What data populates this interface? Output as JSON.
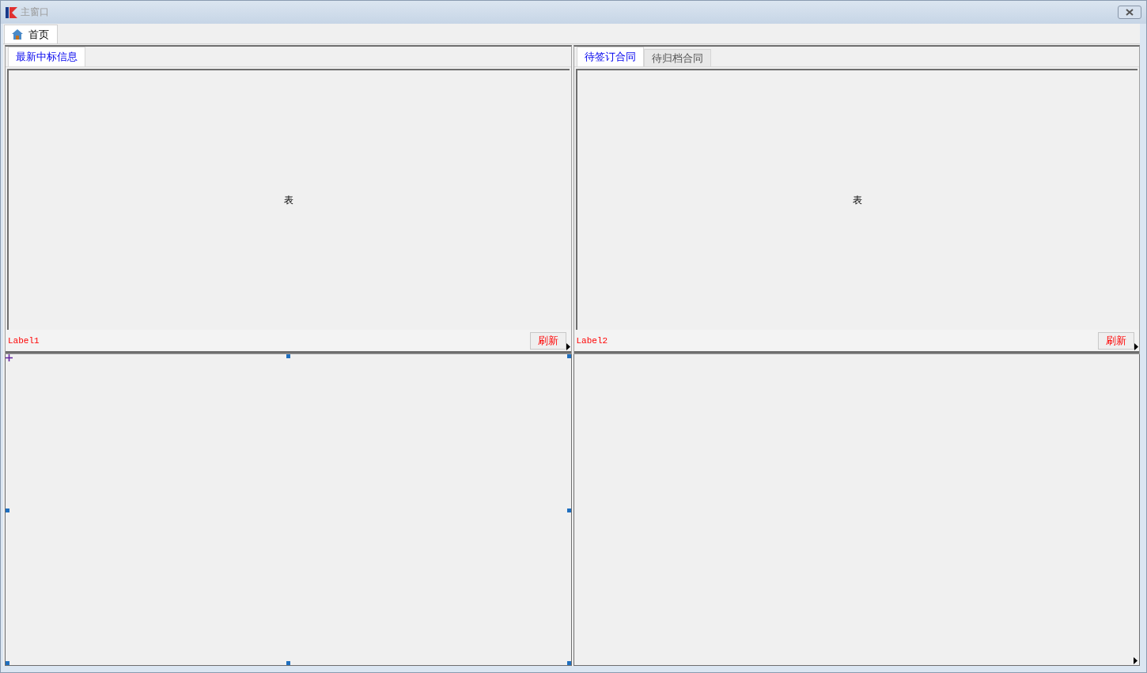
{
  "window": {
    "title": "主窗口"
  },
  "main_tabs": [
    {
      "label": "首页",
      "selected": true
    }
  ],
  "top_panels": [
    {
      "tabs": [
        {
          "label": "最新中标信息",
          "selected": true
        }
      ],
      "table_label": "表",
      "footer_label": "Label1",
      "refresh_button": "刷新"
    },
    {
      "tabs": [
        {
          "label": "待签订合同",
          "selected": true
        },
        {
          "label": "待归档合同",
          "selected": false
        }
      ],
      "table_label": "表",
      "footer_label": "Label2",
      "refresh_button": "刷新"
    }
  ],
  "bottom_panels": [
    {
      "selected": true
    },
    {
      "selected": false
    }
  ]
}
